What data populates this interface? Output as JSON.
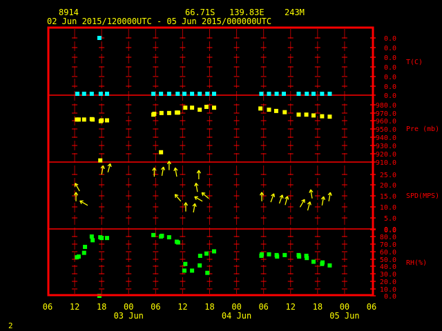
{
  "header": {
    "station": "8914",
    "lat": "66.71S",
    "lon": "139.83E",
    "elev": "243M",
    "title": "02 Jun 2015/120000UTC - 05 Jun 2015/000000UTC"
  },
  "footer": {
    "frame_number": "2"
  },
  "colors": {
    "frame": "#ff0000",
    "text": "#ffff00",
    "temp": "#00ffff",
    "pres": "#ffff00",
    "wind": "#ffff00",
    "rh": "#00ff00"
  },
  "chart_data": {
    "type": "scatter",
    "x_unit": "hours since 02 Jun 2015 06UTC",
    "xlim": [
      0,
      72
    ],
    "x_tick_labels": [
      "06",
      "12",
      "18",
      "00",
      "06",
      "12",
      "18",
      "00",
      "06",
      "12",
      "18",
      "00",
      "06"
    ],
    "date_labels": [
      {
        "hour": 18,
        "label": "03 Jun"
      },
      {
        "hour": 42,
        "label": "04 Jun"
      },
      {
        "hour": 66,
        "label": "05 Jun"
      }
    ],
    "panels": [
      {
        "name": "temperature",
        "ylabel": "T(C)",
        "ylim": [
          0,
          0.6
        ],
        "tick_labels": [
          "0.0",
          "0.0",
          "0.0",
          "0.0",
          "0.0",
          "0.0",
          "0.0"
        ],
        "color": "#00ffff",
        "points": [
          [
            11.5,
            0.6
          ],
          [
            6.6,
            0
          ],
          [
            8.1,
            0
          ],
          [
            9.8,
            0
          ],
          [
            11.8,
            0
          ],
          [
            13.2,
            0
          ],
          [
            23.5,
            0
          ],
          [
            25.2,
            0
          ],
          [
            27.0,
            0
          ],
          [
            28.9,
            0
          ],
          [
            30.4,
            0
          ],
          [
            32.1,
            0
          ],
          [
            33.8,
            0
          ],
          [
            35.5,
            0
          ],
          [
            37.0,
            0
          ],
          [
            47.5,
            0
          ],
          [
            49.2,
            0
          ],
          [
            50.9,
            0
          ],
          [
            52.5,
            0
          ],
          [
            55.8,
            0
          ],
          [
            57.6,
            0
          ],
          [
            59.1,
            0
          ],
          [
            61.0,
            0
          ],
          [
            62.7,
            0
          ]
        ]
      },
      {
        "name": "pressure",
        "ylabel": "Pre (mb)",
        "ylim": [
          910,
          990
        ],
        "tick_labels": [
          "980.0",
          "970.0",
          "960.0",
          "950.0",
          "940.0",
          "930.0",
          "920.0",
          "910.0"
        ],
        "color": "#ffff00",
        "points": [
          [
            6.5,
            962
          ],
          [
            6.9,
            962
          ],
          [
            8.1,
            962
          ],
          [
            9.8,
            962.5
          ],
          [
            10.0,
            962
          ],
          [
            11.8,
            960
          ],
          [
            12.0,
            961
          ],
          [
            13.2,
            961
          ],
          [
            11.7,
            912
          ],
          [
            23.5,
            968
          ],
          [
            23.7,
            969
          ],
          [
            25.3,
            970
          ],
          [
            27.0,
            970
          ],
          [
            28.7,
            970.5
          ],
          [
            29.0,
            970.5
          ],
          [
            30.6,
            976.5
          ],
          [
            32.1,
            976.5
          ],
          [
            33.8,
            974
          ],
          [
            35.3,
            977.5
          ],
          [
            37.0,
            976.5
          ],
          [
            25.2,
            922
          ],
          [
            47.3,
            975.5
          ],
          [
            49.2,
            974
          ],
          [
            50.8,
            972.5
          ],
          [
            52.7,
            971
          ],
          [
            55.8,
            968
          ],
          [
            57.5,
            968
          ],
          [
            59.1,
            967
          ],
          [
            61.0,
            966
          ],
          [
            62.7,
            965.5
          ]
        ]
      },
      {
        "name": "wind",
        "ylabel": "SPD(MPS)",
        "ylim": [
          0,
          30
        ],
        "tick_labels": [
          "25.0",
          "20.0",
          "15.0",
          "10.0",
          "5.0",
          "0.0"
        ],
        "color": "#ffff00",
        "points_hour_speed_dir": [
          [
            6.3,
            12.7,
            0
          ],
          [
            7.1,
            17.4,
            -30
          ],
          [
            8.9,
            10.8,
            -60
          ],
          [
            12.0,
            25,
            10
          ],
          [
            13.4,
            26,
            15
          ],
          [
            23.7,
            24,
            0
          ],
          [
            25.4,
            24.4,
            10
          ],
          [
            27.0,
            27,
            0
          ],
          [
            28.7,
            24,
            -10
          ],
          [
            29.6,
            12.7,
            -40
          ],
          [
            30.7,
            8,
            0
          ],
          [
            32.4,
            7.6,
            10
          ],
          [
            33.6,
            22.8,
            0
          ],
          [
            33.3,
            17,
            -10
          ],
          [
            34.4,
            12.7,
            -60
          ],
          [
            35.8,
            14,
            -50
          ],
          [
            47.6,
            12.7,
            0
          ],
          [
            49.6,
            12.3,
            20
          ],
          [
            51.5,
            11.7,
            20
          ],
          [
            52.8,
            11,
            15
          ],
          [
            56.1,
            10,
            30
          ],
          [
            57.8,
            8.5,
            15
          ],
          [
            58.8,
            14,
            -10
          ],
          [
            61.0,
            10.8,
            10
          ],
          [
            62.5,
            12.7,
            10
          ]
        ]
      },
      {
        "name": "relative-humidity",
        "ylabel": "RH(%)",
        "ylim": [
          0,
          90
        ],
        "tick_labels": [
          "0.0",
          "80.0",
          "70.0",
          "60.0",
          "50.0",
          "40.0",
          "30.0",
          "20.0",
          "10.0",
          "0.0"
        ],
        "color": "#00ff00",
        "points": [
          [
            6.5,
            52
          ],
          [
            6.9,
            53
          ],
          [
            8.1,
            58
          ],
          [
            8.3,
            66
          ],
          [
            9.8,
            80
          ],
          [
            10.0,
            75
          ],
          [
            11.7,
            79
          ],
          [
            12.0,
            78
          ],
          [
            13.2,
            78
          ],
          [
            11.5,
            0
          ],
          [
            23.5,
            82
          ],
          [
            25.2,
            80
          ],
          [
            25.4,
            81
          ],
          [
            27.0,
            79
          ],
          [
            28.7,
            73
          ],
          [
            29.0,
            72
          ],
          [
            30.6,
            43
          ],
          [
            30.4,
            34
          ],
          [
            32.1,
            34
          ],
          [
            33.8,
            41
          ],
          [
            33.9,
            54
          ],
          [
            35.3,
            57
          ],
          [
            35.5,
            31
          ],
          [
            37.0,
            60
          ],
          [
            47.5,
            54
          ],
          [
            47.6,
            56
          ],
          [
            49.2,
            56
          ],
          [
            50.9,
            55
          ],
          [
            51.0,
            53
          ],
          [
            52.7,
            55
          ],
          [
            55.8,
            55
          ],
          [
            55.9,
            53
          ],
          [
            57.5,
            54
          ],
          [
            57.6,
            51
          ],
          [
            59.1,
            46
          ],
          [
            61.0,
            43
          ],
          [
            61.1,
            45
          ],
          [
            62.7,
            41
          ]
        ]
      }
    ]
  }
}
